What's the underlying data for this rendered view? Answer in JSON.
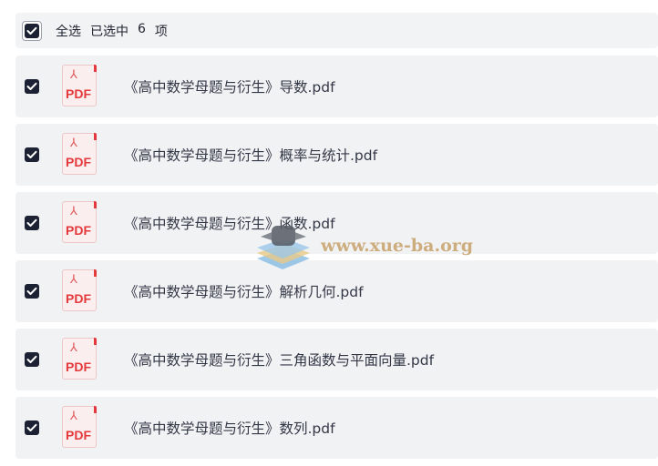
{
  "header": {
    "select_all_label": "全选",
    "selected_prefix": "已选中",
    "selected_count": "6",
    "selected_suffix": "项"
  },
  "files": [
    {
      "name": "《高中数学母题与衍生》导数.pdf",
      "icon": "pdf-icon",
      "icon_label": "PDF",
      "checked": true
    },
    {
      "name": "《高中数学母题与衍生》概率与统计.pdf",
      "icon": "pdf-icon",
      "icon_label": "PDF",
      "checked": true
    },
    {
      "name": "《高中数学母题与衍生》函数.pdf",
      "icon": "pdf-icon",
      "icon_label": "PDF",
      "checked": true
    },
    {
      "name": "《高中数学母题与衍生》解析几何.pdf",
      "icon": "pdf-icon",
      "icon_label": "PDF",
      "checked": true
    },
    {
      "name": "《高中数学母题与衍生》三角函数与平面向量.pdf",
      "icon": "pdf-icon",
      "icon_label": "PDF",
      "checked": true
    },
    {
      "name": "《高中数学母题与衍生》数列.pdf",
      "icon": "pdf-icon",
      "icon_label": "PDF",
      "checked": true
    }
  ],
  "watermark": {
    "text": "www.xue-ba.org"
  },
  "colors": {
    "checkbox_fill": "#1c2233",
    "row_background": "#f1f2f4",
    "pdf_red": "#e4393c",
    "watermark_gold": "#c7a06a"
  }
}
